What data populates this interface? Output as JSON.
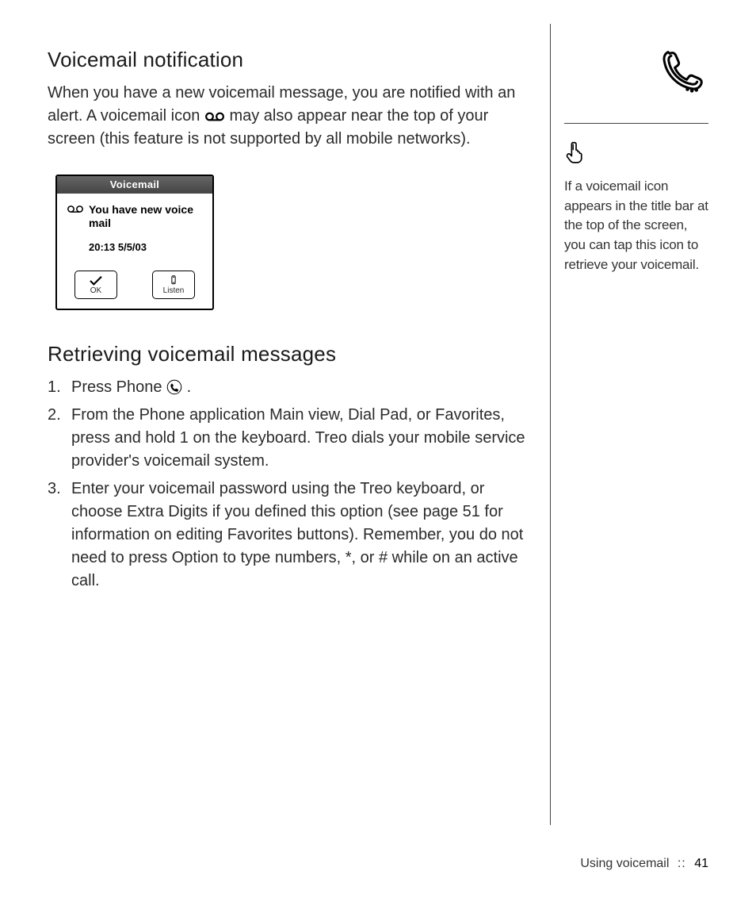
{
  "section1": {
    "heading": "Voicemail notification",
    "para_a": "When you have a new voicemail message, you are notified with an alert. A voicemail icon ",
    "para_b": " may also appear near the top of your screen (this feature is not supported by all mobile networks)."
  },
  "phonebox": {
    "title": "Voicemail",
    "message": "You have new voice mail",
    "timestamp": "20:13 5/5/03",
    "ok_label": "OK",
    "listen_label": "Listen"
  },
  "section2": {
    "heading": "Retrieving voicemail messages",
    "items": {
      "n1": "1.",
      "t1a": "Press Phone ",
      "t1b": ".",
      "n2": "2.",
      "t2": "From the Phone application Main view, Dial Pad, or Favorites, press and hold 1 on the keyboard. Treo dials your mobile service provider's voicemail system.",
      "n3": "3.",
      "t3": "Enter your voicemail password using the Treo keyboard, or choose Extra Digits if you defined this option (see page 51 for information on editing Favorites buttons). Remember, you do not need to press Option to type numbers, *, or # while on an active call."
    }
  },
  "tip": "If a voicemail icon appears in the title bar at the top of the screen, you can tap this icon to retrieve your voicemail.",
  "footer": {
    "section": "Using voicemail",
    "sep": "::",
    "page": "41"
  }
}
